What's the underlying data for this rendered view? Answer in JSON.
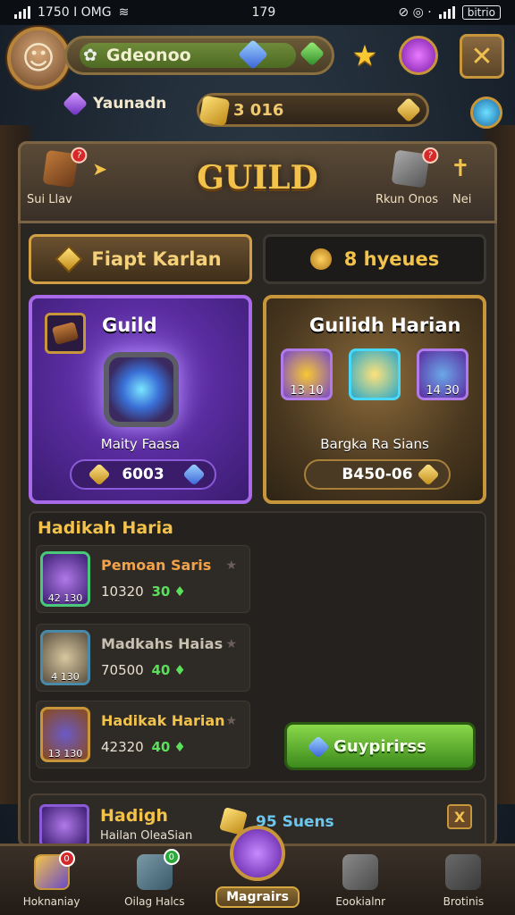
{
  "status_bar": {
    "left_text": "1750 I OMG",
    "time": "179",
    "battery": "bitrio"
  },
  "player": {
    "name": "Gdeonoo",
    "guild_label": "Yaunadn",
    "gold": "3 016"
  },
  "header": {
    "title": "GUILD",
    "left_label": "Sui Llav",
    "right_label": "Rkun Onos",
    "right_extra": "Nei",
    "left_badge": "?",
    "right_badge": "?"
  },
  "tabs": [
    {
      "label": "Fiapt Karlan"
    },
    {
      "label": "8 hyeues",
      "icon_text": "0"
    }
  ],
  "cards": {
    "guild": {
      "title": "Guild",
      "subtitle": "Maity Faasa",
      "price": "6003"
    },
    "harian": {
      "title": "Guilidh Harian",
      "subtitle": "Bargka Ra Sians",
      "price": "B450-06",
      "items": [
        "13 10",
        "",
        "14 30"
      ]
    }
  },
  "list": {
    "title": "Hadikah Haria",
    "rows": [
      {
        "name": "Pemoan Saris",
        "value": "10320",
        "bonus": "30",
        "icon_label": "42 130"
      },
      {
        "name": "Madkahs Haias",
        "value": "70500",
        "bonus": "40",
        "icon_label": "4 130"
      },
      {
        "name": "Hadikak Harian",
        "value": "42320",
        "bonus": "40",
        "icon_label": "13 130"
      }
    ],
    "buy_button": "Guypirirss"
  },
  "bottom_card": {
    "title": "Hadigh",
    "subtitle": "Hailan OleaSian",
    "label": "95 Suens",
    "close": "X"
  },
  "nav": [
    {
      "label": "Hoknaniay",
      "badge": "0"
    },
    {
      "label": "Oilag Halcs",
      "badge": "0"
    },
    {
      "label": "Magrairs"
    },
    {
      "label": "Eookialnr"
    },
    {
      "label": "Brotinis"
    }
  ],
  "colors": {
    "accent_gold": "#f2c24a",
    "purple_card": "#5a2ca0",
    "buy_green": "#5aa82a"
  }
}
